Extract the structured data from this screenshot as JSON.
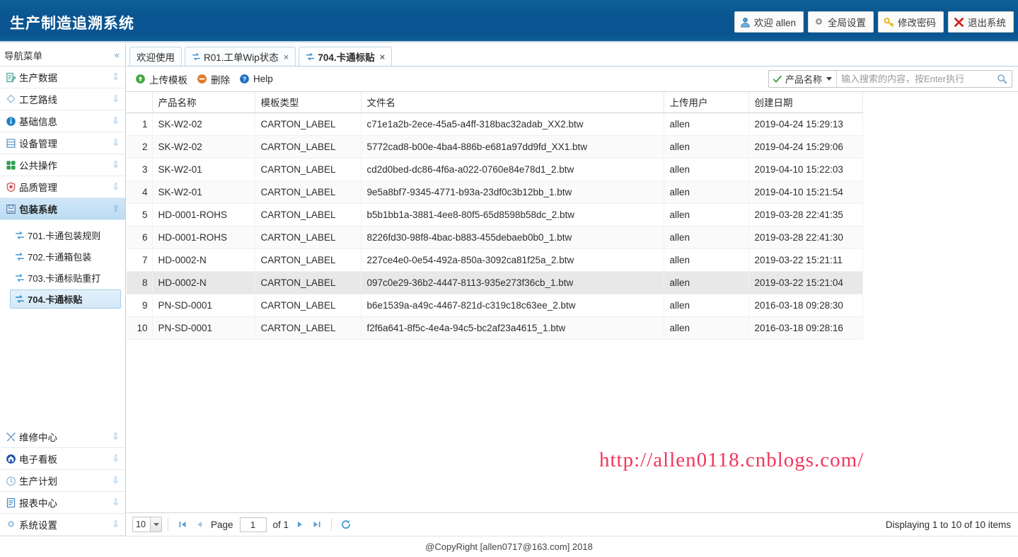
{
  "header": {
    "app_title": "生产制造追溯系统",
    "brand_color": "#0a5591",
    "buttons": [
      {
        "label": "欢迎 allen",
        "icon": "user-icon"
      },
      {
        "label": "全局设置",
        "icon": "gear-icon"
      },
      {
        "label": "修改密码",
        "icon": "key-icon"
      },
      {
        "label": "退出系统",
        "icon": "close-x-icon"
      }
    ]
  },
  "sidebar": {
    "nav_title": "导航菜单",
    "collapse_icon": "double-chevron-left-icon",
    "items": [
      {
        "label": "生产数据",
        "icon": "document-edit-icon",
        "expanded": false
      },
      {
        "label": "工艺路线",
        "icon": "route-icon",
        "expanded": false
      },
      {
        "label": "基础信息",
        "icon": "info-icon",
        "expanded": false
      },
      {
        "label": "设备管理",
        "icon": "server-icon",
        "expanded": false
      },
      {
        "label": "公共操作",
        "icon": "grid-green-icon",
        "expanded": false
      },
      {
        "label": "品质管理",
        "icon": "shield-icon",
        "expanded": false
      },
      {
        "label": "包装系统",
        "icon": "package-icon",
        "expanded": true
      }
    ],
    "submenu": [
      {
        "label": "701.卡通包装规则",
        "icon": "arrows-icon",
        "selected": false
      },
      {
        "label": "702.卡通箱包装",
        "icon": "arrows-icon",
        "selected": false
      },
      {
        "label": "703.卡通标贴重打",
        "icon": "arrows-icon",
        "selected": false
      },
      {
        "label": "704.卡通标贴",
        "icon": "arrows-icon",
        "selected": true
      }
    ],
    "lower_items": [
      {
        "label": "维修中心",
        "icon": "tools-icon",
        "expanded": false
      },
      {
        "label": "电子看板",
        "icon": "monitor-icon",
        "expanded": false
      },
      {
        "label": "生产计划",
        "icon": "clock-icon",
        "expanded": false
      },
      {
        "label": "报表中心",
        "icon": "report-icon",
        "expanded": false
      },
      {
        "label": "系统设置",
        "icon": "gear-icon",
        "expanded": false
      }
    ]
  },
  "tabs": [
    {
      "label": "欢迎使用",
      "icon": null,
      "closable": false,
      "active": false
    },
    {
      "label": "R01.工单Wip状态",
      "icon": "arrows-icon",
      "closable": true,
      "active": false
    },
    {
      "label": "704.卡通标贴",
      "icon": "arrows-icon",
      "closable": true,
      "active": true
    }
  ],
  "toolbar": {
    "upload_label": "上传模板",
    "upload_icon": "upload-green-icon",
    "delete_label": "删除",
    "delete_icon": "minus-orange-icon",
    "help_label": "Help",
    "help_icon": "question-blue-icon"
  },
  "search": {
    "field_label": "产品名称",
    "field_icon": "check-green-icon",
    "placeholder": "输入搜索的内容，按Enter执行",
    "value": "",
    "search_icon": "search-icon"
  },
  "table": {
    "columns": [
      "",
      "产品名称",
      "模板类型",
      "文件名",
      "上传用户",
      "创建日期"
    ],
    "rows": [
      {
        "no": "1",
        "product": "SK-W2-02",
        "type": "CARTON_LABEL",
        "file": "c71e1a2b-2ece-45a5-a4ff-318bac32adab_XX2.btw",
        "user": "allen",
        "date": "2019-04-24 15:29:13"
      },
      {
        "no": "2",
        "product": "SK-W2-02",
        "type": "CARTON_LABEL",
        "file": "5772cad8-b00e-4ba4-886b-e681a97dd9fd_XX1.btw",
        "user": "allen",
        "date": "2019-04-24 15:29:06"
      },
      {
        "no": "3",
        "product": "SK-W2-01",
        "type": "CARTON_LABEL",
        "file": "cd2d0bed-dc86-4f6a-a022-0760e84e78d1_2.btw",
        "user": "allen",
        "date": "2019-04-10 15:22:03"
      },
      {
        "no": "4",
        "product": "SK-W2-01",
        "type": "CARTON_LABEL",
        "file": "9e5a8bf7-9345-4771-b93a-23df0c3b12bb_1.btw",
        "user": "allen",
        "date": "2019-04-10 15:21:54"
      },
      {
        "no": "5",
        "product": "HD-0001-ROHS",
        "type": "CARTON_LABEL",
        "file": "b5b1bb1a-3881-4ee8-80f5-65d8598b58dc_2.btw",
        "user": "allen",
        "date": "2019-03-28 22:41:35"
      },
      {
        "no": "6",
        "product": "HD-0001-ROHS",
        "type": "CARTON_LABEL",
        "file": "8226fd30-98f8-4bac-b883-455debaeb0b0_1.btw",
        "user": "allen",
        "date": "2019-03-28 22:41:30"
      },
      {
        "no": "7",
        "product": "HD-0002-N",
        "type": "CARTON_LABEL",
        "file": "227ce4e0-0e54-492a-850a-3092ca81f25a_2.btw",
        "user": "allen",
        "date": "2019-03-22 15:21:11"
      },
      {
        "no": "8",
        "product": "HD-0002-N",
        "type": "CARTON_LABEL",
        "file": "097c0e29-36b2-4447-8113-935e273f36cb_1.btw",
        "user": "allen",
        "date": "2019-03-22 15:21:04"
      },
      {
        "no": "9",
        "product": "PN-SD-0001",
        "type": "CARTON_LABEL",
        "file": "b6e1539a-a49c-4467-821d-c319c18c63ee_2.btw",
        "user": "allen",
        "date": "2016-03-18 09:28:30"
      },
      {
        "no": "10",
        "product": "PN-SD-0001",
        "type": "CARTON_LABEL",
        "file": "f2f6a641-8f5c-4e4a-94c5-bc2af23a4615_1.btw",
        "user": "allen",
        "date": "2016-03-18 09:28:16"
      }
    ],
    "highlight_row_index": 7
  },
  "watermark": {
    "text": "http://allen0118.cnblogs.com/",
    "color": "#f4355a"
  },
  "pager": {
    "page_size": "10",
    "page_word": "Page",
    "page_value": "1",
    "of_label": "of 1",
    "first_icon": "first-page-icon",
    "prev_icon": "prev-page-icon",
    "next_icon": "next-page-icon",
    "last_icon": "last-page-icon",
    "refresh_icon": "refresh-icon",
    "status": "Displaying 1 to 10 of 10 items"
  },
  "footer": {
    "copyright": "@CopyRight [allen0717@163.com] 2018"
  }
}
